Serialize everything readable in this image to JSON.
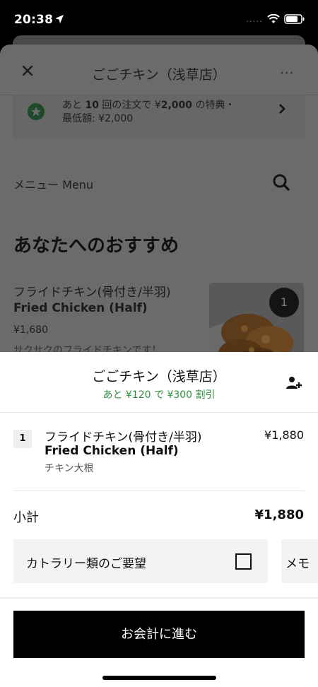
{
  "status_bar": {
    "time": "20:38",
    "signal": ".....",
    "icons": [
      "location-arrow-icon",
      "wifi-icon",
      "battery-icon"
    ]
  },
  "store_sheet": {
    "title": "ごごチキン（浅草店）",
    "close_icon": "close-icon",
    "more": "···",
    "promo": {
      "line1_prefix": "あと",
      "line1_count": "10",
      "line1_mid": "回の注文で ¥",
      "line1_amount": "2,000",
      "line1_suffix": "の特典・",
      "line2": "最低額: ¥2,000",
      "icon": "star-badge-icon"
    },
    "menu_label": "メニュー Menu",
    "section_heading": "あなたへのおすすめ",
    "item": {
      "title_jp": "フライドチキン(骨付き/半羽)",
      "title_en": "Fried Chicken (Half)",
      "price": "¥1,680",
      "description": "サクサクのフライドチキンです！",
      "badge": "1"
    }
  },
  "cart": {
    "store_name": "ごごチキン（浅草店）",
    "discount_note": "あと ¥120 で ¥300 割引",
    "add_person_icon": "add-person-icon",
    "items": [
      {
        "qty": "1",
        "name_jp": "フライドチキン(骨付き/半羽)",
        "name_en": "Fried Chicken (Half)",
        "option": "チキン大根",
        "price": "¥1,880"
      }
    ],
    "subtotal_label": "小計",
    "subtotal_value": "¥1,880",
    "cutlery_label": "カトラリー類のご要望",
    "memo_label": "メモ",
    "checkout_label": "お会計に進む"
  },
  "colors": {
    "accent_green": "#2e8f3f",
    "primary_button": "#000000",
    "overlay": "#6b6b6b"
  }
}
